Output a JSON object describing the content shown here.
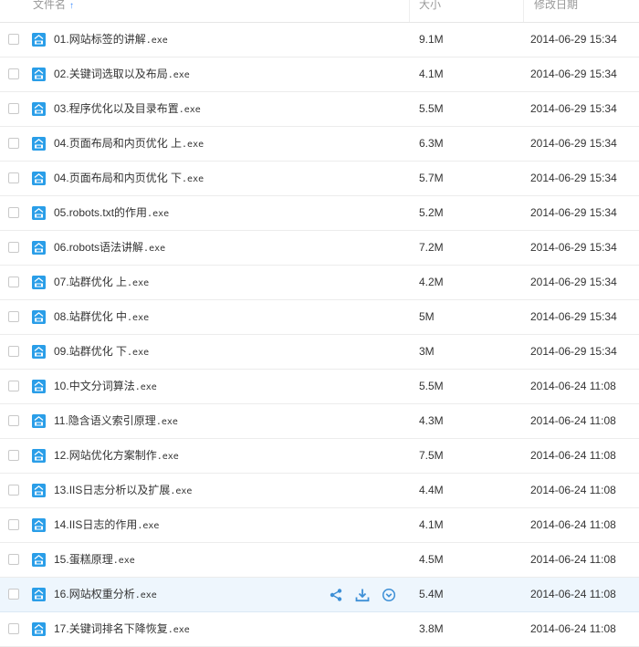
{
  "columns": {
    "name": "文件名",
    "size": "大小",
    "modified": "修改日期"
  },
  "accent_color": "#2a9ee8",
  "rows": [
    {
      "prefix": "01.",
      "title": "网站标签的讲解",
      "ext": ".exe",
      "size": "9.1M",
      "date": "2014-06-29 15:34"
    },
    {
      "prefix": "02.",
      "title": "关键词选取以及布局",
      "ext": ".exe",
      "size": "4.1M",
      "date": "2014-06-29 15:34"
    },
    {
      "prefix": "03.",
      "title": "程序优化以及目录布置",
      "ext": ".exe",
      "size": "5.5M",
      "date": "2014-06-29 15:34"
    },
    {
      "prefix": "04.",
      "title": "页面布局和内页优化 上",
      "ext": ".exe",
      "size": "6.3M",
      "date": "2014-06-29 15:34"
    },
    {
      "prefix": "04.",
      "title": "页面布局和内页优化 下",
      "ext": ".exe",
      "size": "5.7M",
      "date": "2014-06-29 15:34"
    },
    {
      "prefix": "05.",
      "title": "robots.txt的作用",
      "ext": ".exe",
      "size": "5.2M",
      "date": "2014-06-29 15:34"
    },
    {
      "prefix": "06.",
      "title": "robots语法讲解",
      "ext": ".exe",
      "size": "7.2M",
      "date": "2014-06-29 15:34"
    },
    {
      "prefix": "07.",
      "title": "站群优化 上",
      "ext": ".exe",
      "size": "4.2M",
      "date": "2014-06-29 15:34"
    },
    {
      "prefix": "08.",
      "title": "站群优化 中",
      "ext": ".exe",
      "size": "5M",
      "date": "2014-06-29 15:34"
    },
    {
      "prefix": "09.",
      "title": "站群优化 下",
      "ext": ".exe",
      "size": "3M",
      "date": "2014-06-29 15:34"
    },
    {
      "prefix": "10.",
      "title": "中文分词算法",
      "ext": ".exe",
      "size": "5.5M",
      "date": "2014-06-24 11:08"
    },
    {
      "prefix": "11.",
      "title": "隐含语义索引原理",
      "ext": ".exe",
      "size": "4.3M",
      "date": "2014-06-24 11:08"
    },
    {
      "prefix": "12.",
      "title": "网站优化方案制作",
      "ext": ".exe",
      "size": "7.5M",
      "date": "2014-06-24 11:08"
    },
    {
      "prefix": "13.",
      "title": "IIS日志分析以及扩展",
      "ext": ".exe",
      "size": "4.4M",
      "date": "2014-06-24 11:08"
    },
    {
      "prefix": "14.",
      "title": "IIS日志的作用",
      "ext": ".exe",
      "size": "4.1M",
      "date": "2014-06-24 11:08"
    },
    {
      "prefix": "15.",
      "title": "蛋糕原理",
      "ext": ".exe",
      "size": "4.5M",
      "date": "2014-06-24 11:08"
    },
    {
      "prefix": "16.",
      "title": "网站权重分析",
      "ext": ".exe",
      "size": "5.4M",
      "date": "2014-06-24 11:08",
      "hover": true
    },
    {
      "prefix": "17.",
      "title": "关键词排名下降恢复",
      "ext": ".exe",
      "size": "3.8M",
      "date": "2014-06-24 11:08"
    }
  ]
}
